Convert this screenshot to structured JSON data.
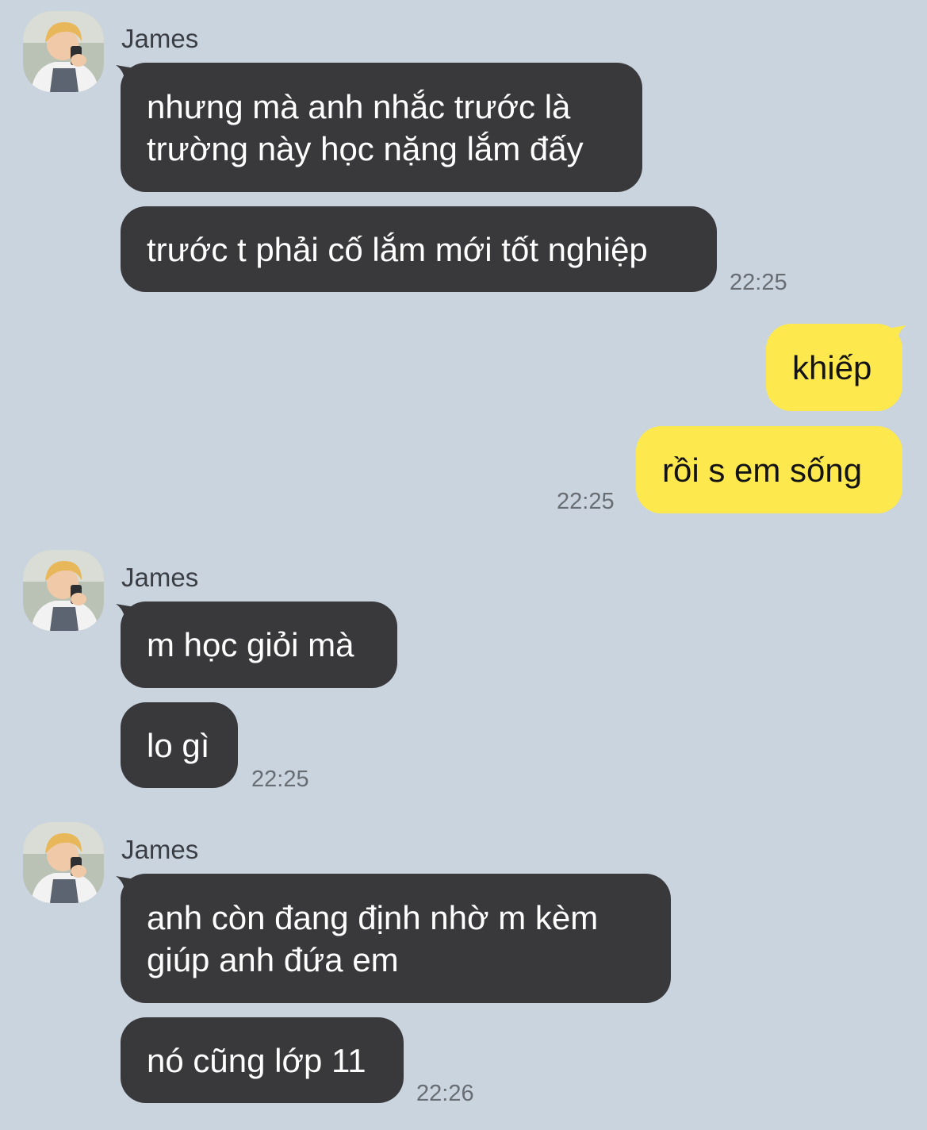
{
  "colors": {
    "background": "#cad4df",
    "incoming_bubble": "#39393c",
    "outgoing_bubble": "#fde84d",
    "timestamp": "#686d74"
  },
  "groups": [
    {
      "sender": "James",
      "messages": [
        "nhưng mà anh nhắc trước là\ntrường này học nặng lắm đấy",
        "trước t phải cố lắm mới tốt nghiệp"
      ],
      "time": "22:25"
    },
    {
      "sender": "me",
      "messages": [
        "khiếp",
        "rồi s em sống"
      ],
      "time": "22:25"
    },
    {
      "sender": "James",
      "messages": [
        "m học giỏi mà",
        "lo gì"
      ],
      "time": "22:25"
    },
    {
      "sender": "James",
      "messages": [
        "anh còn đang định nhờ m kèm\ngiúp anh đứa em",
        "nó cũng lớp 11"
      ],
      "time": "22:26"
    }
  ],
  "avatar_icon": "profile-photo-icon"
}
